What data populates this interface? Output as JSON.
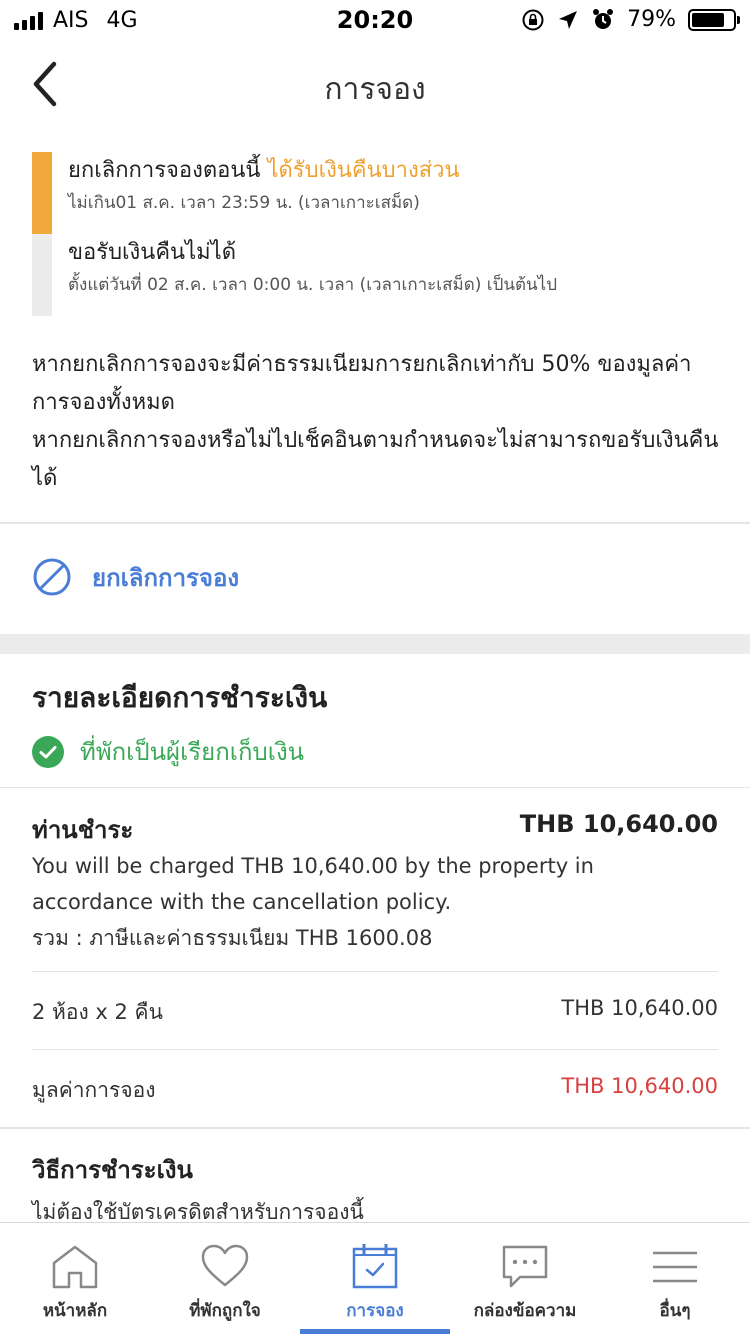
{
  "status_bar": {
    "carrier": "AIS",
    "network": "4G",
    "time": "20:20",
    "battery": "79%",
    "battery_level": 0.79
  },
  "nav": {
    "title": "การจอง"
  },
  "timeline": [
    {
      "title": "ยกเลิกการจองตอนนี้",
      "highlight": "ได้รับเงินคืนบางส่วน",
      "subtitle": "ไม่เกิน01 ส.ค. เวลา 23:59 น. (เวลาเกาะเสม็ด)"
    },
    {
      "title": "ขอรับเงินคืนไม่ได้",
      "subtitle": "ตั้งแต่วันที่ 02 ส.ค. เวลา 0:00 น. เวลา (เวลาเกาะเสม็ด) เป็นต้นไป"
    }
  ],
  "policy": [
    "หากยกเลิกการจองจะมีค่าธรรมเนียมการยกเลิกเท่ากับ 50% ของมูลค่าการจองทั้งหมด",
    "หากยกเลิกการจองหรือไม่ไปเช็คอินตามกำหนดจะไม่สามารถขอรับเงินคืนได้"
  ],
  "cancel": {
    "label": "ยกเลิกการจอง"
  },
  "payment": {
    "title": "รายละเอียดการชำระเงิน",
    "status": "ที่พักเป็นผู้เรียกเก็บเงิน",
    "charge_label": "ท่านชำระ",
    "charge_amount": "THB 10,640.00",
    "charge_note": "You will be charged THB 10,640.00 by the property in accordance with the cancellation policy.",
    "tax_note": "รวม : ภาษีและค่าธรรมเนียม THB 1600.08",
    "rows": [
      {
        "label": "2 ห้อง x 2 คืน",
        "value": "THB 10,640.00"
      },
      {
        "label": "มูลค่าการจอง",
        "value": "THB 10,640.00"
      }
    ],
    "method_title": "วิธีการชำระเงิน",
    "method_desc": "ไม่ต้องใช้บัตรเครดิตสำหรับการจองนี้"
  },
  "tabs": [
    {
      "label": "หน้าหลัก",
      "icon": "home-icon"
    },
    {
      "label": "ที่พักถูกใจ",
      "icon": "heart-icon"
    },
    {
      "label": "การจอง",
      "icon": "calendar-check-icon",
      "active": true
    },
    {
      "label": "กล่องข้อความ",
      "icon": "chat-icon"
    },
    {
      "label": "อื่นๆ",
      "icon": "menu-icon"
    }
  ],
  "colors": {
    "accent": "#4a7dd6",
    "orange": "#f0a030",
    "green": "#3aa857",
    "red": "#d84040"
  }
}
